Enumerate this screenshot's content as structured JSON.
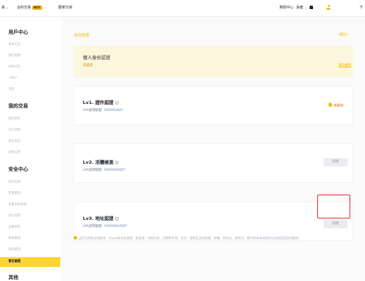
{
  "topnav": {
    "item_1": "易",
    "item_2": "合約交易",
    "hot_badge": "HOT",
    "item_3": "跟單交易",
    "help_center": "幫助中心",
    "assets": "資產",
    "language_partial": "下"
  },
  "sidebar": {
    "user_center": {
      "title": "用戶中心",
      "items": [
        "基本信息",
        "我的推薦",
        "財務日誌",
        "子賬戶",
        "消息"
      ]
    },
    "my_trades": {
      "title": "我的交易",
      "items": [
        "我的委託",
        "成交明細",
        "歷史委託",
        "結算交割"
      ]
    },
    "security": {
      "title": "安全中心",
      "items": [
        "修改密碼",
        "雙重驗證",
        "設置防釣魚碼",
        "地址管理",
        "設備管理",
        "郵箱驗證",
        "電話驗證",
        "實名驗證"
      ],
      "active": "實名驗證"
    },
    "other": {
      "title": "其他"
    }
  },
  "main": {
    "title": "身份認證",
    "help": "規則>",
    "banner": {
      "title": "個人身份認證",
      "status": "未認證",
      "link": "我的權限"
    },
    "levels": [
      {
        "title": "Lv1. 證件認證",
        "limit_label": "24h提現額度: ",
        "limit_value": "50000USDT",
        "status": "待審核"
      },
      {
        "title": "Lv2. 活體檢測",
        "limit_label": "24h提現額度: ",
        "limit_value": "500000USDT",
        "button": "認證"
      },
      {
        "title": "Lv3. 地址認證",
        "limit_label": "24h提現額度: ",
        "limit_value": "1000000USDT",
        "button": "認證"
      }
    ],
    "notice": "出於法律和合規要求，Kcpkt無法為美國、新加坡、中國大陸、巴爾幹半島、古巴、朝鮮民主共和國、伊朗、伊拉克、敘利亞、蘇丹和其和地區的公民和居民提供服務。"
  },
  "colors": {
    "accent": "#f0b90b",
    "active_bg": "#fcd535",
    "banner_bg": "#fdf6dc",
    "pending": "#e8711a",
    "highlight": "#e02424"
  }
}
